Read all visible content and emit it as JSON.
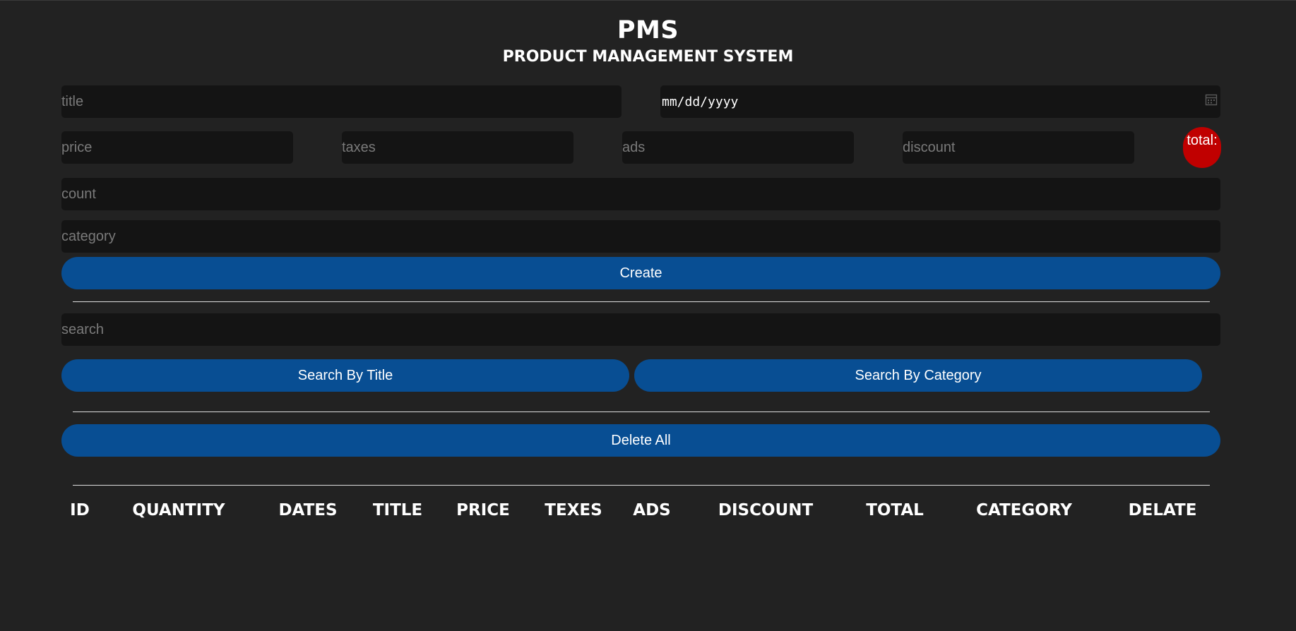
{
  "header": {
    "title": "PMS",
    "subtitle": "PRODUCT MANAGEMENT SYSTEM"
  },
  "form": {
    "title_placeholder": "title",
    "date_placeholder": "mm/dd/yyyy",
    "price_placeholder": "price",
    "taxes_placeholder": "taxes",
    "ads_placeholder": "ads",
    "discount_placeholder": "discount",
    "total_label": "total:",
    "count_placeholder": "count",
    "category_placeholder": "category",
    "create_label": "Create"
  },
  "search": {
    "placeholder": "search",
    "by_title_label": "Search By Title",
    "by_category_label": "Search By Category"
  },
  "actions": {
    "delete_all_label": "Delete All"
  },
  "table": {
    "columns": [
      "ID",
      "QUANTITY",
      "DATES",
      "TITLE",
      "PRICE",
      "TEXES",
      "ADS",
      "DISCOUNT",
      "TOTAL",
      "CATEGORY",
      "DELATE"
    ]
  },
  "colors": {
    "background": "#222222",
    "input_background": "#141414",
    "button": "#084e93",
    "total_badge": "#c00000"
  },
  "icons": {
    "date_picker": "calendar-icon"
  }
}
